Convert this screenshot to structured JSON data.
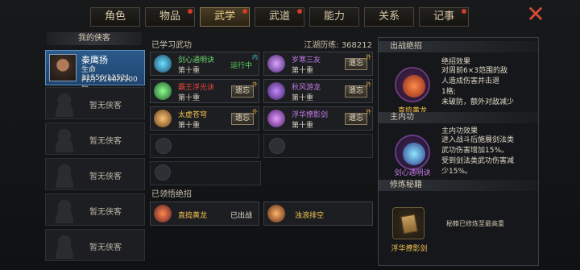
{
  "tabs": [
    {
      "label": "角色",
      "badge": false,
      "active": false
    },
    {
      "label": "物品",
      "badge": true,
      "active": false
    },
    {
      "label": "武学",
      "badge": true,
      "active": true
    },
    {
      "label": "武道",
      "badge": true,
      "active": false
    },
    {
      "label": "能力",
      "badge": false,
      "active": false
    },
    {
      "label": "关系",
      "badge": false,
      "active": false
    },
    {
      "label": "记事",
      "badge": true,
      "active": false
    }
  ],
  "close_icon": "✕",
  "followers": {
    "title": "我的侠客",
    "hero": {
      "name": "秦鹰扬",
      "hp": "生命 11556/12521",
      "mp": "内力 1100/1100 阳"
    },
    "empty_label": "暂无侠客",
    "empty_slots": 6
  },
  "learned": {
    "title": "已学习武功",
    "experience": "江湖历练: 368212",
    "level_text": "第十重",
    "forget_label": "遗忘",
    "running_label": "运行中",
    "skills": [
      {
        "name": "剑心通明诀",
        "tag": "内",
        "running": true,
        "color": "#4fe07a"
      },
      {
        "name": "岁寒三友",
        "tag": "外",
        "running": false,
        "color": "#c67be6"
      },
      {
        "name": "霸王浮光诀",
        "tag": "外",
        "running": false,
        "color": "#e8473a"
      },
      {
        "name": "秋风游龙",
        "tag": "外",
        "running": false,
        "color": "#c67be6"
      },
      {
        "name": "太虚苍穹",
        "tag": "外",
        "running": false,
        "color": "#f2c14d"
      },
      {
        "name": "浮华撩影剑",
        "tag": "外",
        "running": false,
        "color": "#c67be6"
      }
    ]
  },
  "comprehended": {
    "title": "已领悟绝招",
    "items": [
      {
        "name": "直捣黄龙",
        "status": "已出战",
        "color": "#f2c14d"
      },
      {
        "name": "浊浪排空",
        "status": "",
        "color": "#f2c14d"
      }
    ]
  },
  "right_panel": {
    "battle_title": "出战绝招",
    "battle_name": "直捣黄龙",
    "battle_effect_title": "绝招效果",
    "battle_effect": [
      "对周前6×3范围的敌",
      "人造成伤害并击退",
      "1格;",
      "未破防，额外对敌减少"
    ],
    "inner_title": "主内功",
    "inner_name": "剑心通明诀",
    "inner_effect_title": "主内功效果",
    "inner_effect": [
      "进入战斗后施展剑法类",
      "武功伤害增加15%。",
      "受到剑法类武功伤害减",
      "少15%。"
    ],
    "manual_title": "修炼秘籍",
    "manual_name": "浮华撩影剑",
    "manual_note": "秘籍已修炼至最高重"
  },
  "colors": {
    "accent": "#f2c14d",
    "purple": "#c67be6",
    "red": "#e8473a",
    "green": "#5bd45b",
    "selected": "#2b5a8a"
  }
}
